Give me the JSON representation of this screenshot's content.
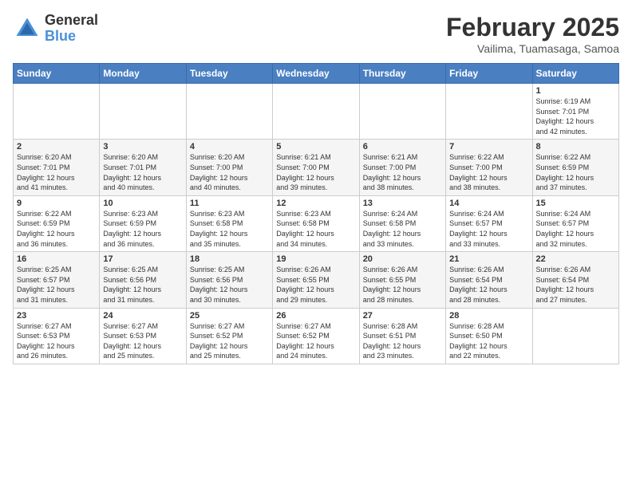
{
  "header": {
    "logo_general": "General",
    "logo_blue": "Blue",
    "title": "February 2025",
    "subtitle": "Vailima, Tuamasaga, Samoa"
  },
  "days_of_week": [
    "Sunday",
    "Monday",
    "Tuesday",
    "Wednesday",
    "Thursday",
    "Friday",
    "Saturday"
  ],
  "weeks": [
    [
      {
        "day": "",
        "info": ""
      },
      {
        "day": "",
        "info": ""
      },
      {
        "day": "",
        "info": ""
      },
      {
        "day": "",
        "info": ""
      },
      {
        "day": "",
        "info": ""
      },
      {
        "day": "",
        "info": ""
      },
      {
        "day": "1",
        "info": "Sunrise: 6:19 AM\nSunset: 7:01 PM\nDaylight: 12 hours\nand 42 minutes."
      }
    ],
    [
      {
        "day": "2",
        "info": "Sunrise: 6:20 AM\nSunset: 7:01 PM\nDaylight: 12 hours\nand 41 minutes."
      },
      {
        "day": "3",
        "info": "Sunrise: 6:20 AM\nSunset: 7:01 PM\nDaylight: 12 hours\nand 40 minutes."
      },
      {
        "day": "4",
        "info": "Sunrise: 6:20 AM\nSunset: 7:00 PM\nDaylight: 12 hours\nand 40 minutes."
      },
      {
        "day": "5",
        "info": "Sunrise: 6:21 AM\nSunset: 7:00 PM\nDaylight: 12 hours\nand 39 minutes."
      },
      {
        "day": "6",
        "info": "Sunrise: 6:21 AM\nSunset: 7:00 PM\nDaylight: 12 hours\nand 38 minutes."
      },
      {
        "day": "7",
        "info": "Sunrise: 6:22 AM\nSunset: 7:00 PM\nDaylight: 12 hours\nand 38 minutes."
      },
      {
        "day": "8",
        "info": "Sunrise: 6:22 AM\nSunset: 6:59 PM\nDaylight: 12 hours\nand 37 minutes."
      }
    ],
    [
      {
        "day": "9",
        "info": "Sunrise: 6:22 AM\nSunset: 6:59 PM\nDaylight: 12 hours\nand 36 minutes."
      },
      {
        "day": "10",
        "info": "Sunrise: 6:23 AM\nSunset: 6:59 PM\nDaylight: 12 hours\nand 36 minutes."
      },
      {
        "day": "11",
        "info": "Sunrise: 6:23 AM\nSunset: 6:58 PM\nDaylight: 12 hours\nand 35 minutes."
      },
      {
        "day": "12",
        "info": "Sunrise: 6:23 AM\nSunset: 6:58 PM\nDaylight: 12 hours\nand 34 minutes."
      },
      {
        "day": "13",
        "info": "Sunrise: 6:24 AM\nSunset: 6:58 PM\nDaylight: 12 hours\nand 33 minutes."
      },
      {
        "day": "14",
        "info": "Sunrise: 6:24 AM\nSunset: 6:57 PM\nDaylight: 12 hours\nand 33 minutes."
      },
      {
        "day": "15",
        "info": "Sunrise: 6:24 AM\nSunset: 6:57 PM\nDaylight: 12 hours\nand 32 minutes."
      }
    ],
    [
      {
        "day": "16",
        "info": "Sunrise: 6:25 AM\nSunset: 6:57 PM\nDaylight: 12 hours\nand 31 minutes."
      },
      {
        "day": "17",
        "info": "Sunrise: 6:25 AM\nSunset: 6:56 PM\nDaylight: 12 hours\nand 31 minutes."
      },
      {
        "day": "18",
        "info": "Sunrise: 6:25 AM\nSunset: 6:56 PM\nDaylight: 12 hours\nand 30 minutes."
      },
      {
        "day": "19",
        "info": "Sunrise: 6:26 AM\nSunset: 6:55 PM\nDaylight: 12 hours\nand 29 minutes."
      },
      {
        "day": "20",
        "info": "Sunrise: 6:26 AM\nSunset: 6:55 PM\nDaylight: 12 hours\nand 28 minutes."
      },
      {
        "day": "21",
        "info": "Sunrise: 6:26 AM\nSunset: 6:54 PM\nDaylight: 12 hours\nand 28 minutes."
      },
      {
        "day": "22",
        "info": "Sunrise: 6:26 AM\nSunset: 6:54 PM\nDaylight: 12 hours\nand 27 minutes."
      }
    ],
    [
      {
        "day": "23",
        "info": "Sunrise: 6:27 AM\nSunset: 6:53 PM\nDaylight: 12 hours\nand 26 minutes."
      },
      {
        "day": "24",
        "info": "Sunrise: 6:27 AM\nSunset: 6:53 PM\nDaylight: 12 hours\nand 25 minutes."
      },
      {
        "day": "25",
        "info": "Sunrise: 6:27 AM\nSunset: 6:52 PM\nDaylight: 12 hours\nand 25 minutes."
      },
      {
        "day": "26",
        "info": "Sunrise: 6:27 AM\nSunset: 6:52 PM\nDaylight: 12 hours\nand 24 minutes."
      },
      {
        "day": "27",
        "info": "Sunrise: 6:28 AM\nSunset: 6:51 PM\nDaylight: 12 hours\nand 23 minutes."
      },
      {
        "day": "28",
        "info": "Sunrise: 6:28 AM\nSunset: 6:50 PM\nDaylight: 12 hours\nand 22 minutes."
      },
      {
        "day": "",
        "info": ""
      }
    ]
  ]
}
